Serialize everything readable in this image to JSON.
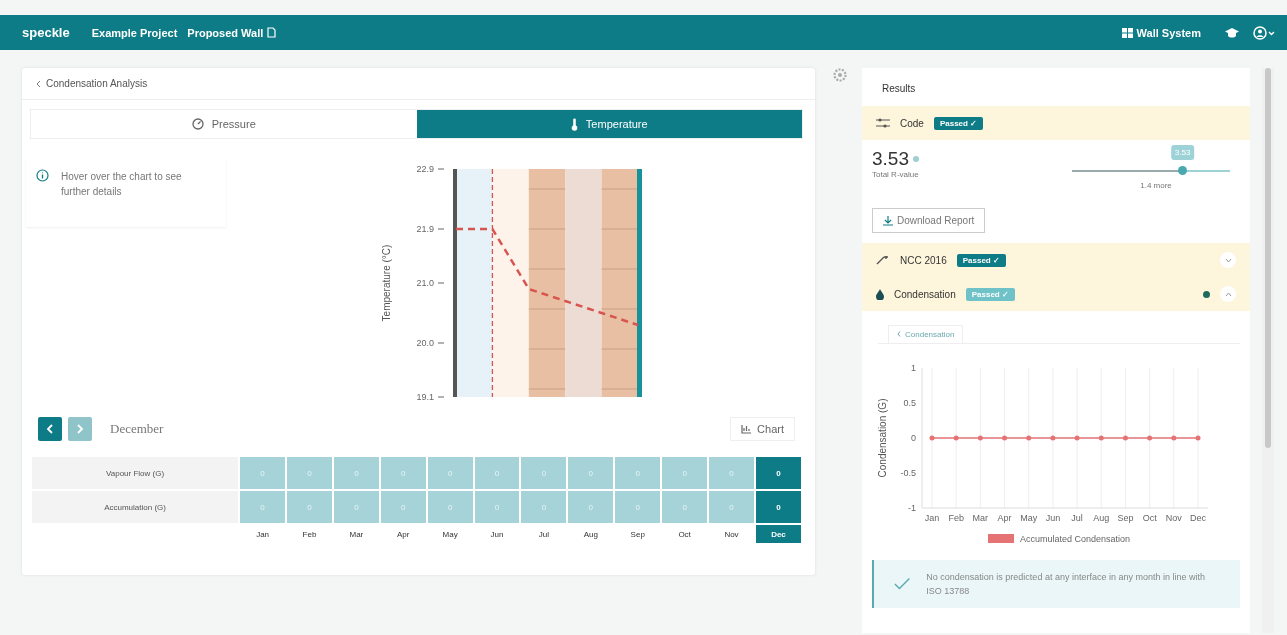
{
  "header": {
    "logo": "speckle",
    "breadcrumbs": [
      {
        "label": "Example Project"
      },
      {
        "label": "Proposed Wall"
      }
    ],
    "system_button": "Wall System"
  },
  "analysis": {
    "back_label": "Condensation Analysis",
    "tabs": [
      {
        "label": "Pressure",
        "selected": false
      },
      {
        "label": "Temperature",
        "selected": true
      }
    ],
    "hint": "Hover over the chart to see further details",
    "chart_data": {
      "type": "line",
      "ylabel": "Temperature (°C)",
      "ylim": [
        19.1,
        22.9
      ],
      "yticks": [
        19.1,
        {
          "value": 20,
          "label": "20.0"
        },
        {
          "value": 21,
          "label": "21.0"
        },
        21.9,
        22.9
      ],
      "series": [
        {
          "color": "#d9534f",
          "line_style": "dashed",
          "values": [
            21.9,
            21.9,
            20.9,
            20.7,
            20.5,
            20.3
          ]
        }
      ]
    },
    "nav": {
      "prev_disabled": false,
      "next_disabled": true
    },
    "month": "December",
    "chart_button": "Chart",
    "table": {
      "rows": [
        {
          "label": "Vapour Flow (G)",
          "values": [
            "0",
            "0",
            "0",
            "0",
            "0",
            "0",
            "0",
            "0",
            "0",
            "0",
            "0",
            "0"
          ]
        },
        {
          "label": "Accumulation (G)",
          "values": [
            "0",
            "0",
            "0",
            "0",
            "0",
            "0",
            "0",
            "0",
            "0",
            "0",
            "0",
            "0"
          ]
        }
      ],
      "months": [
        {
          "label": "Jan",
          "selected": false
        },
        {
          "label": "Feb",
          "selected": false
        },
        {
          "label": "Mar",
          "selected": false
        },
        {
          "label": "Apr",
          "selected": false
        },
        {
          "label": "May",
          "selected": false
        },
        {
          "label": "Jun",
          "selected": false
        },
        {
          "label": "Jul",
          "selected": false
        },
        {
          "label": "Aug",
          "selected": false
        },
        {
          "label": "Sep",
          "selected": false
        },
        {
          "label": "Oct",
          "selected": false
        },
        {
          "label": "Nov",
          "selected": false
        },
        {
          "label": "Dec",
          "selected": true
        }
      ]
    }
  },
  "results": {
    "title": "Results",
    "code": {
      "label": "Code",
      "badge": "Passed ✓"
    },
    "r_value": {
      "value": "3.53",
      "label": "Total R-value",
      "slider": {
        "level": 0.7,
        "bubble": "3.53",
        "caption": "1.4 more"
      }
    },
    "download_button": "Download Report",
    "checks": [
      {
        "kind": "ncc",
        "label": "NCC 2016",
        "badge": "Passed ✓",
        "expanded": false,
        "indicator": false
      },
      {
        "kind": "condensation",
        "label": "Condensation",
        "badge": "Passed ✓",
        "expanded": true,
        "indicator": true
      }
    ],
    "panel_tab": "Condensation",
    "chart_data": {
      "type": "line",
      "grid": true,
      "ylabel": "Condensation (G)",
      "categories": [
        "Jan",
        "Feb",
        "Mar",
        "Apr",
        "May",
        "Jun",
        "Jul",
        "Aug",
        "Sep",
        "Oct",
        "Nov",
        "Dec"
      ],
      "ylim": [
        -1,
        1
      ],
      "yticks": [
        -1,
        -0.5,
        0,
        0.5,
        1
      ],
      "series": [
        {
          "name": "Accumulated Condensation",
          "color": "#e57373",
          "values": [
            0,
            0,
            0,
            0,
            0,
            0,
            0,
            0,
            0,
            0,
            0,
            0
          ]
        }
      ]
    },
    "alert": "No condensation is predicted at any interface in any month in line with ISO 13788"
  }
}
